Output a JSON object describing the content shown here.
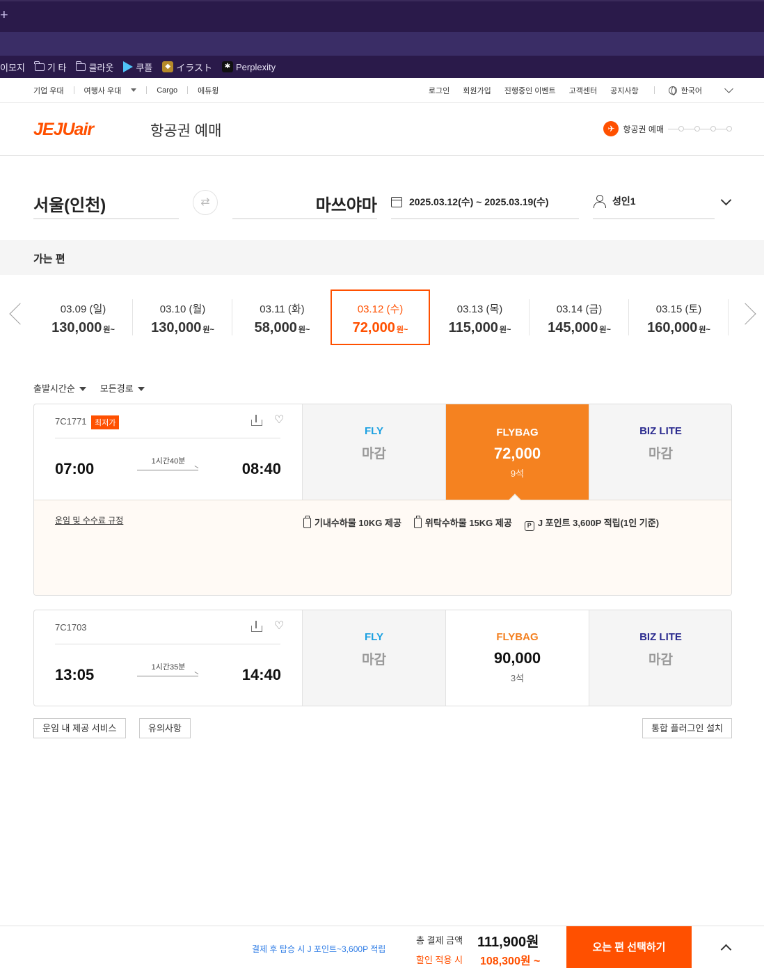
{
  "browser": {
    "new_tab": "+",
    "bookmarks": [
      {
        "label": "이모지",
        "icon": "none"
      },
      {
        "label": "기  타",
        "icon": "folder-icon"
      },
      {
        "label": "클라웃",
        "icon": "folder-icon"
      },
      {
        "label": "쿠플",
        "icon": "play-icon"
      },
      {
        "label": "イラスト",
        "icon": "badge-icon"
      },
      {
        "label": "Perplexity",
        "icon": "perplexity-icon"
      }
    ]
  },
  "utilnav": {
    "left": [
      "기업 우대",
      "여행사 우대",
      "Cargo",
      "에듀윙"
    ],
    "right": [
      "로그인",
      "회원가입",
      "진행중인 이벤트",
      "고객센터",
      "공지사항"
    ],
    "language": "한국어"
  },
  "header": {
    "logo_main": "JEJU",
    "logo_sub": "air",
    "title": "항공권 예매",
    "step_label": "항공권 예매"
  },
  "search": {
    "from": "서울(인천)",
    "to": "마쓰야마",
    "dates": "2025.03.12(수) ~ 2025.03.19(수)",
    "passengers": "성인1"
  },
  "section_title": "가는 편",
  "date_options": [
    {
      "date": "03.09 (일)",
      "price": "130,000",
      "unit": "원~",
      "active": false
    },
    {
      "date": "03.10 (월)",
      "price": "130,000",
      "unit": "원~",
      "active": false
    },
    {
      "date": "03.11 (화)",
      "price": "58,000",
      "unit": "원~",
      "active": false
    },
    {
      "date": "03.12 (수)",
      "price": "72,000",
      "unit": "원~",
      "active": true
    },
    {
      "date": "03.13 (목)",
      "price": "115,000",
      "unit": "원~",
      "active": false
    },
    {
      "date": "03.14 (금)",
      "price": "145,000",
      "unit": "원~",
      "active": false
    },
    {
      "date": "03.15 (토)",
      "price": "160,000",
      "unit": "원~",
      "active": false
    }
  ],
  "filters": [
    "출발시간순",
    "모든경로"
  ],
  "flights": [
    {
      "number": "7C1771",
      "badge": "최저가",
      "depart": "07:00",
      "arrive": "08:40",
      "duration": "1시간40분",
      "fares": [
        {
          "name": "FLY",
          "status": "마감"
        },
        {
          "name": "FLYBAG",
          "price": "72,000",
          "seats": "9석"
        },
        {
          "name": "BIZ LITE",
          "status": "마감"
        }
      ],
      "detail": {
        "rules_link": "운임 및 수수료 규정",
        "benefits": [
          "기내수하물 10KG 제공",
          "위탁수하물 15KG 제공",
          "J 포인트 3,600P 적립(1인 기준)"
        ]
      }
    },
    {
      "number": "7C1703",
      "depart": "13:05",
      "arrive": "14:40",
      "duration": "1시간35분",
      "fares": [
        {
          "name": "FLY",
          "status": "마감"
        },
        {
          "name": "FLYBAG",
          "price": "90,000",
          "seats": "3석"
        },
        {
          "name": "BIZ LITE",
          "status": "마감"
        }
      ]
    }
  ],
  "buttons": {
    "services": "운임 내 제공 서비스",
    "notice": "유의사항",
    "plugin": "통합 플러그인 설치"
  },
  "footer": {
    "points_note": "결제 후 탑승 시 J 포인트~3,600P 적립",
    "total_label": "총 결제 금액",
    "total_value": "111,900원",
    "discount_label": "할인 적용 시",
    "discount_value": "108,300원 ~",
    "next_button": "오는 편 선택하기"
  },
  "colors": {
    "brand": "#ff5000",
    "flybag_selected": "#f58220",
    "fly": "#1ba0e1",
    "biz_lite": "#2b2b8f"
  }
}
